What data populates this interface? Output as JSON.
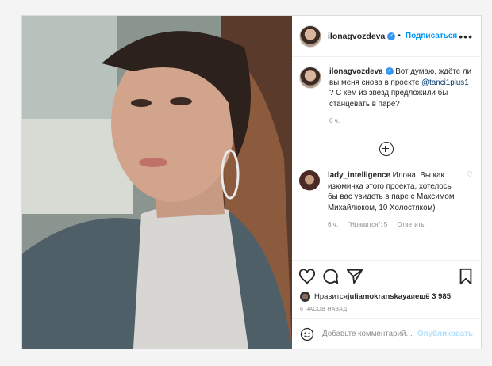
{
  "post": {
    "username": "ilonagvozdeva",
    "verified_glyph": "✓",
    "dot": "•",
    "follow_label": "Подписаться",
    "more_label": "•••",
    "caption": {
      "username": "ilonagvozdeva",
      "text_1": " Вот думаю, ждёте ли вы меня снова в проекте ",
      "mention": "@tanci1plus1",
      "text_2": " ? С кем из звёзд предложили бы станцевать в паре?",
      "time": "6 ч."
    },
    "comment": {
      "username": "lady_intelligence",
      "text": " Илона, Вы как изюминка этого проекта, хотелось бы вас увидеть в паре с Максимом Михайлюком, 10 Холостяком)",
      "time": "6 ч.",
      "likes": "\"Нравится\": 5",
      "reply": "Ответить"
    },
    "likes": {
      "prefix": "Нравится ",
      "user": "juliamokranskaya",
      "middle": " и ",
      "count": "ещё 3 985"
    },
    "timestamp": "6 ЧАСОВ НАЗАД",
    "add_comment_placeholder": "Добавьте комментарий...",
    "publish_label": "Опубликовать",
    "icons": [
      "heart-icon",
      "comment-icon",
      "share-icon",
      "bookmark-icon",
      "emoji-icon",
      "plus-circle-icon"
    ]
  }
}
